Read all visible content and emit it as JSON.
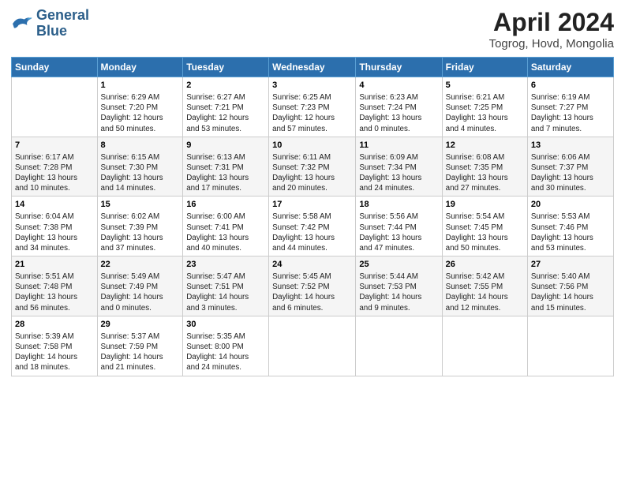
{
  "header": {
    "logo_line1": "General",
    "logo_line2": "Blue",
    "title": "April 2024",
    "subtitle": "Togrog, Hovd, Mongolia"
  },
  "days_of_week": [
    "Sunday",
    "Monday",
    "Tuesday",
    "Wednesday",
    "Thursday",
    "Friday",
    "Saturday"
  ],
  "weeks": [
    [
      {
        "day": "",
        "content": ""
      },
      {
        "day": "1",
        "content": "Sunrise: 6:29 AM\nSunset: 7:20 PM\nDaylight: 12 hours\nand 50 minutes."
      },
      {
        "day": "2",
        "content": "Sunrise: 6:27 AM\nSunset: 7:21 PM\nDaylight: 12 hours\nand 53 minutes."
      },
      {
        "day": "3",
        "content": "Sunrise: 6:25 AM\nSunset: 7:23 PM\nDaylight: 12 hours\nand 57 minutes."
      },
      {
        "day": "4",
        "content": "Sunrise: 6:23 AM\nSunset: 7:24 PM\nDaylight: 13 hours\nand 0 minutes."
      },
      {
        "day": "5",
        "content": "Sunrise: 6:21 AM\nSunset: 7:25 PM\nDaylight: 13 hours\nand 4 minutes."
      },
      {
        "day": "6",
        "content": "Sunrise: 6:19 AM\nSunset: 7:27 PM\nDaylight: 13 hours\nand 7 minutes."
      }
    ],
    [
      {
        "day": "7",
        "content": "Sunrise: 6:17 AM\nSunset: 7:28 PM\nDaylight: 13 hours\nand 10 minutes."
      },
      {
        "day": "8",
        "content": "Sunrise: 6:15 AM\nSunset: 7:30 PM\nDaylight: 13 hours\nand 14 minutes."
      },
      {
        "day": "9",
        "content": "Sunrise: 6:13 AM\nSunset: 7:31 PM\nDaylight: 13 hours\nand 17 minutes."
      },
      {
        "day": "10",
        "content": "Sunrise: 6:11 AM\nSunset: 7:32 PM\nDaylight: 13 hours\nand 20 minutes."
      },
      {
        "day": "11",
        "content": "Sunrise: 6:09 AM\nSunset: 7:34 PM\nDaylight: 13 hours\nand 24 minutes."
      },
      {
        "day": "12",
        "content": "Sunrise: 6:08 AM\nSunset: 7:35 PM\nDaylight: 13 hours\nand 27 minutes."
      },
      {
        "day": "13",
        "content": "Sunrise: 6:06 AM\nSunset: 7:37 PM\nDaylight: 13 hours\nand 30 minutes."
      }
    ],
    [
      {
        "day": "14",
        "content": "Sunrise: 6:04 AM\nSunset: 7:38 PM\nDaylight: 13 hours\nand 34 minutes."
      },
      {
        "day": "15",
        "content": "Sunrise: 6:02 AM\nSunset: 7:39 PM\nDaylight: 13 hours\nand 37 minutes."
      },
      {
        "day": "16",
        "content": "Sunrise: 6:00 AM\nSunset: 7:41 PM\nDaylight: 13 hours\nand 40 minutes."
      },
      {
        "day": "17",
        "content": "Sunrise: 5:58 AM\nSunset: 7:42 PM\nDaylight: 13 hours\nand 44 minutes."
      },
      {
        "day": "18",
        "content": "Sunrise: 5:56 AM\nSunset: 7:44 PM\nDaylight: 13 hours\nand 47 minutes."
      },
      {
        "day": "19",
        "content": "Sunrise: 5:54 AM\nSunset: 7:45 PM\nDaylight: 13 hours\nand 50 minutes."
      },
      {
        "day": "20",
        "content": "Sunrise: 5:53 AM\nSunset: 7:46 PM\nDaylight: 13 hours\nand 53 minutes."
      }
    ],
    [
      {
        "day": "21",
        "content": "Sunrise: 5:51 AM\nSunset: 7:48 PM\nDaylight: 13 hours\nand 56 minutes."
      },
      {
        "day": "22",
        "content": "Sunrise: 5:49 AM\nSunset: 7:49 PM\nDaylight: 14 hours\nand 0 minutes."
      },
      {
        "day": "23",
        "content": "Sunrise: 5:47 AM\nSunset: 7:51 PM\nDaylight: 14 hours\nand 3 minutes."
      },
      {
        "day": "24",
        "content": "Sunrise: 5:45 AM\nSunset: 7:52 PM\nDaylight: 14 hours\nand 6 minutes."
      },
      {
        "day": "25",
        "content": "Sunrise: 5:44 AM\nSunset: 7:53 PM\nDaylight: 14 hours\nand 9 minutes."
      },
      {
        "day": "26",
        "content": "Sunrise: 5:42 AM\nSunset: 7:55 PM\nDaylight: 14 hours\nand 12 minutes."
      },
      {
        "day": "27",
        "content": "Sunrise: 5:40 AM\nSunset: 7:56 PM\nDaylight: 14 hours\nand 15 minutes."
      }
    ],
    [
      {
        "day": "28",
        "content": "Sunrise: 5:39 AM\nSunset: 7:58 PM\nDaylight: 14 hours\nand 18 minutes."
      },
      {
        "day": "29",
        "content": "Sunrise: 5:37 AM\nSunset: 7:59 PM\nDaylight: 14 hours\nand 21 minutes."
      },
      {
        "day": "30",
        "content": "Sunrise: 5:35 AM\nSunset: 8:00 PM\nDaylight: 14 hours\nand 24 minutes."
      },
      {
        "day": "",
        "content": ""
      },
      {
        "day": "",
        "content": ""
      },
      {
        "day": "",
        "content": ""
      },
      {
        "day": "",
        "content": ""
      }
    ]
  ]
}
